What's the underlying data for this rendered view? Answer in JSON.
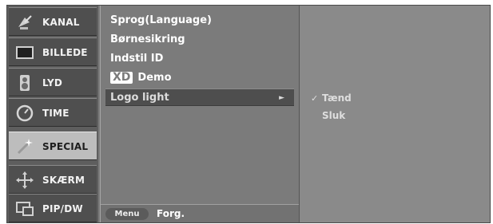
{
  "sidebar": {
    "items": [
      {
        "label": "KANAL",
        "icon": "satellite-dish-icon"
      },
      {
        "label": "BILLEDE",
        "icon": "screen-icon"
      },
      {
        "label": "LYD",
        "icon": "speaker-icon"
      },
      {
        "label": "TIME",
        "icon": "clock-icon"
      },
      {
        "label": "SPECIAL",
        "icon": "wand-icon",
        "active": true
      },
      {
        "label": "SKÆRM",
        "icon": "move-arrows-icon"
      },
      {
        "label": "PIP/DW",
        "icon": "pip-icon"
      }
    ]
  },
  "menu": {
    "items": [
      {
        "label": "Sprog(Language)"
      },
      {
        "label": "Børnesikring"
      },
      {
        "label": "Indstil ID"
      },
      {
        "label": "Demo",
        "logo": "XD"
      },
      {
        "label": "Logo light",
        "selected": true,
        "arrow": "►"
      }
    ],
    "footer": {
      "button": "Menu",
      "text": "Forg."
    }
  },
  "submenu": {
    "options": [
      {
        "label": "Tænd",
        "checked": true,
        "check": "✓"
      },
      {
        "label": "Sluk",
        "checked": false
      }
    ]
  }
}
